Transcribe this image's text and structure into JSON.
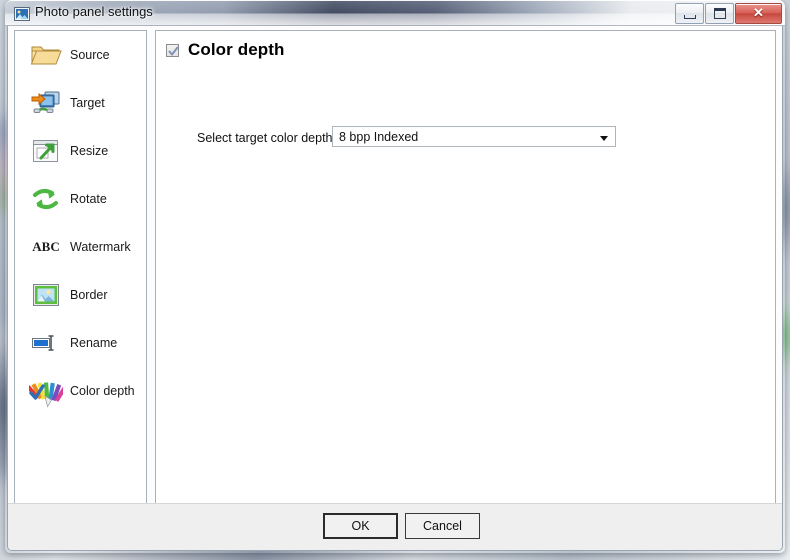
{
  "window": {
    "title": "Photo panel settings",
    "title_icon": "photo-icon",
    "controls": {
      "minimize": "minimize-button",
      "restore": "restore-button",
      "close_glyph": "✕"
    }
  },
  "sidebar": {
    "items": [
      {
        "label": "Source",
        "icon": "folder-icon"
      },
      {
        "label": "Target",
        "icon": "monitor-transfer-icon"
      },
      {
        "label": "Resize",
        "icon": "resize-window-icon"
      },
      {
        "label": "Rotate",
        "icon": "rotate-arrows-icon"
      },
      {
        "label": "Watermark",
        "icon": "abc-text-icon"
      },
      {
        "label": "Border",
        "icon": "framed-picture-icon"
      },
      {
        "label": "Rename",
        "icon": "rename-textfield-icon"
      },
      {
        "label": "Color depth",
        "icon": "color-fan-check-icon"
      }
    ],
    "selected": "Color depth"
  },
  "content": {
    "enable_checkbox_checked": true,
    "page_title": "Color depth",
    "field_label": "Select target color depth",
    "combo": {
      "value": "8 bpp Indexed",
      "arrow": "chevron-down-icon"
    }
  },
  "footer": {
    "ok_label": "OK",
    "cancel_label": "Cancel"
  },
  "colors": {
    "accent_green": "#5cbf3f",
    "accent_orange": "#f08a18",
    "close_red": "#c6483f",
    "check_blue": "#2f6fb5"
  }
}
